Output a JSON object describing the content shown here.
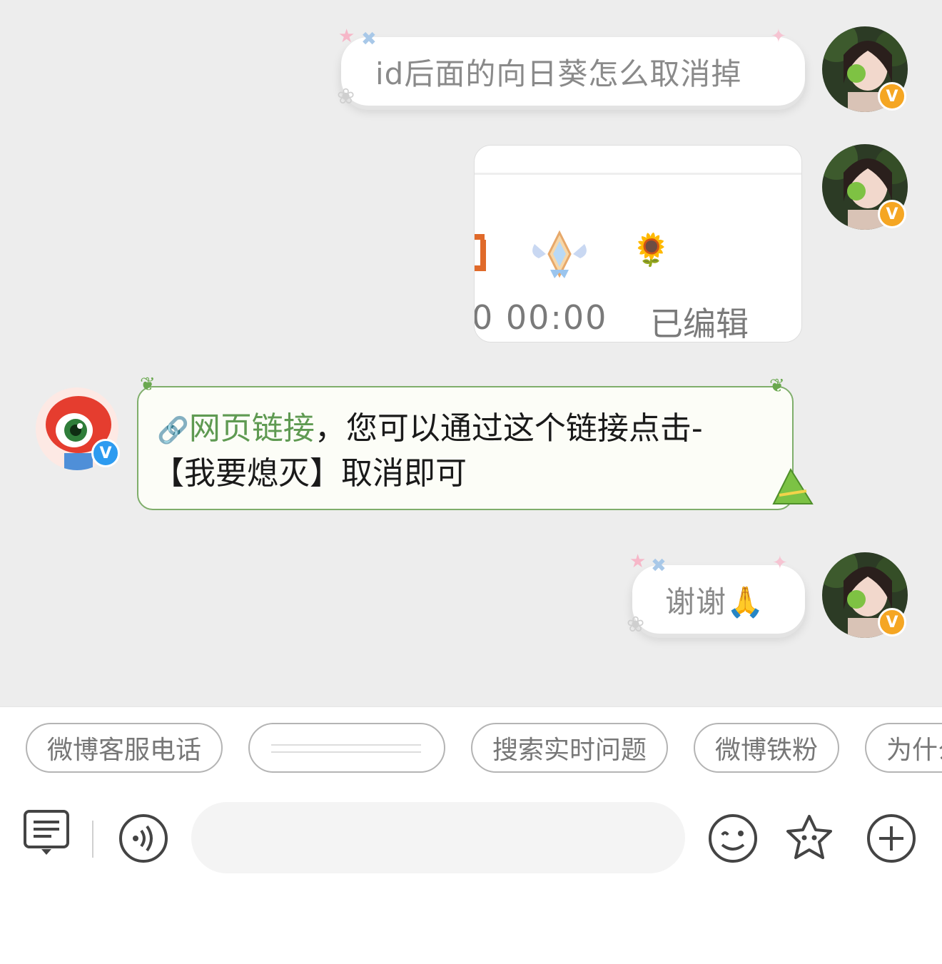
{
  "messages": [
    {
      "side": "right",
      "kind": "text",
      "text": "id后面的向日葵怎么取消掉"
    },
    {
      "side": "right",
      "kind": "screenshot",
      "time_text": "0 00:00",
      "edited_label": "已编辑",
      "items": [
        "badge-icon",
        "sunflower-icon"
      ]
    },
    {
      "side": "left",
      "kind": "text",
      "link_label": "网页链接",
      "line1_rest": "，您可以通过这个链接点击-",
      "line2": "【我要熄灭】取消即可"
    },
    {
      "side": "right",
      "kind": "text",
      "text": "谢谢🙏"
    }
  ],
  "quick_replies": [
    "微博客服电话",
    "",
    "搜索实时问题",
    "微博铁粉",
    "为什么"
  ],
  "input": {
    "placeholder": "",
    "value": ""
  },
  "toolbar": {
    "left": [
      "menu-icon",
      "voice-icon"
    ],
    "right": [
      "emoji-icon",
      "star-face-icon",
      "plus-icon"
    ]
  },
  "colors": {
    "chat_background": "#ededed",
    "link_green": "#5f9a52",
    "bubble_border_green": "#7fae6b",
    "verified_orange": "#f5a623",
    "verified_blue": "#2d9bf0"
  }
}
